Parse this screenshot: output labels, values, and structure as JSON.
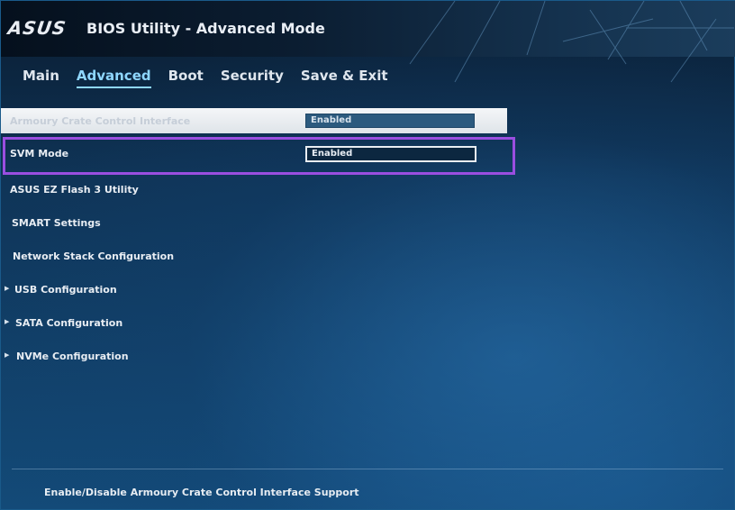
{
  "header": {
    "logo": "ASUS",
    "title": "BIOS Utility - Advanced Mode"
  },
  "tabs": [
    {
      "label": "Main",
      "active": false
    },
    {
      "label": "Advanced",
      "active": true
    },
    {
      "label": "Boot",
      "active": false
    },
    {
      "label": "Security",
      "active": false
    },
    {
      "label": "Save & Exit",
      "active": false
    }
  ],
  "menu": {
    "armoury": {
      "label": "Armoury Crate Control Interface",
      "value": "Enabled"
    },
    "svm": {
      "label": "SVM Mode",
      "value": "Enabled"
    },
    "items": [
      {
        "label": "ASUS EZ Flash 3 Utility"
      },
      {
        "label": "SMART Settings"
      },
      {
        "label": "Network Stack Configuration"
      },
      {
        "label": "USB Configuration"
      },
      {
        "label": "SATA Configuration"
      },
      {
        "label": "NVMe Configuration"
      }
    ]
  },
  "help_text": "Enable/Disable Armoury Crate Control Interface Support",
  "colors": {
    "highlight_frame": "#9a4ee0",
    "active_tab": "#8fd7ff"
  }
}
